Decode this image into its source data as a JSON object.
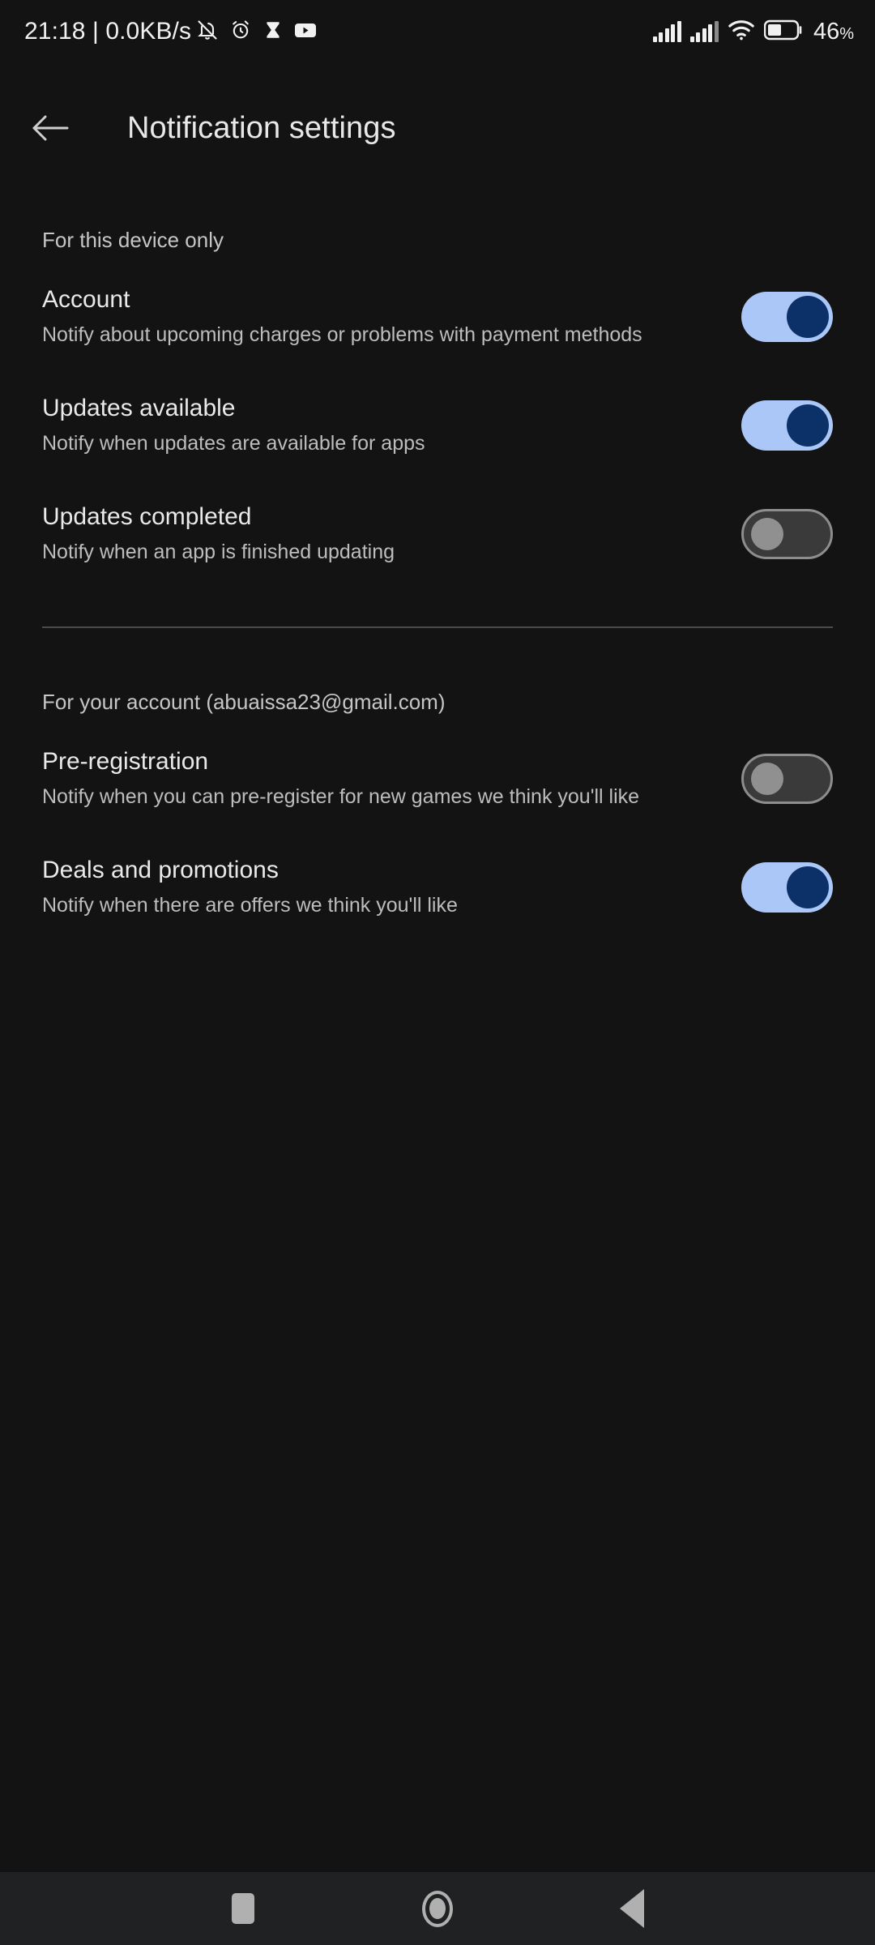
{
  "status_bar": {
    "clock": "21:18 | 0.0KB/s",
    "battery_percent": "46",
    "percent_sign": "%",
    "left_icons": [
      "notifications-off-icon",
      "alarm-icon",
      "hourglass-icon",
      "youtube-icon"
    ],
    "right_icons": [
      "signal-sim1-icon",
      "signal-sim2-icon",
      "wifi-icon",
      "battery-icon"
    ]
  },
  "app_bar": {
    "back_icon": "back-arrow-icon",
    "title": "Notification settings"
  },
  "colors": {
    "background": "#131313",
    "switch_on_track": "#aac7f8",
    "switch_on_knob": "#0c3168",
    "switch_off_track": "#3a3a3a",
    "switch_off_knob": "#909090",
    "title_text": "#e9e9e9",
    "subtitle_text": "#bdbdbd",
    "nav_bar": "#1f2122"
  },
  "sections": [
    {
      "header": "For this device only",
      "rows": [
        {
          "title": "Account",
          "subtitle": "Notify about upcoming charges or problems with payment methods",
          "toggle": "on"
        },
        {
          "title": "Updates available",
          "subtitle": "Notify when updates are available for apps",
          "toggle": "on"
        },
        {
          "title": "Updates completed",
          "subtitle": "Notify when an app is finished updating",
          "toggle": "off"
        }
      ]
    },
    {
      "header": "For your account (abuaissa23@gmail.com)",
      "rows": [
        {
          "title": "Pre-registration",
          "subtitle": "Notify when you can pre-register for new games we think you'll like",
          "toggle": "off"
        },
        {
          "title": "Deals and promotions",
          "subtitle": "Notify when there are offers we think you'll like",
          "toggle": "on"
        }
      ]
    }
  ],
  "nav_bar": {
    "recents_label": "recents-button",
    "home_label": "home-button",
    "back_label": "back-button"
  }
}
